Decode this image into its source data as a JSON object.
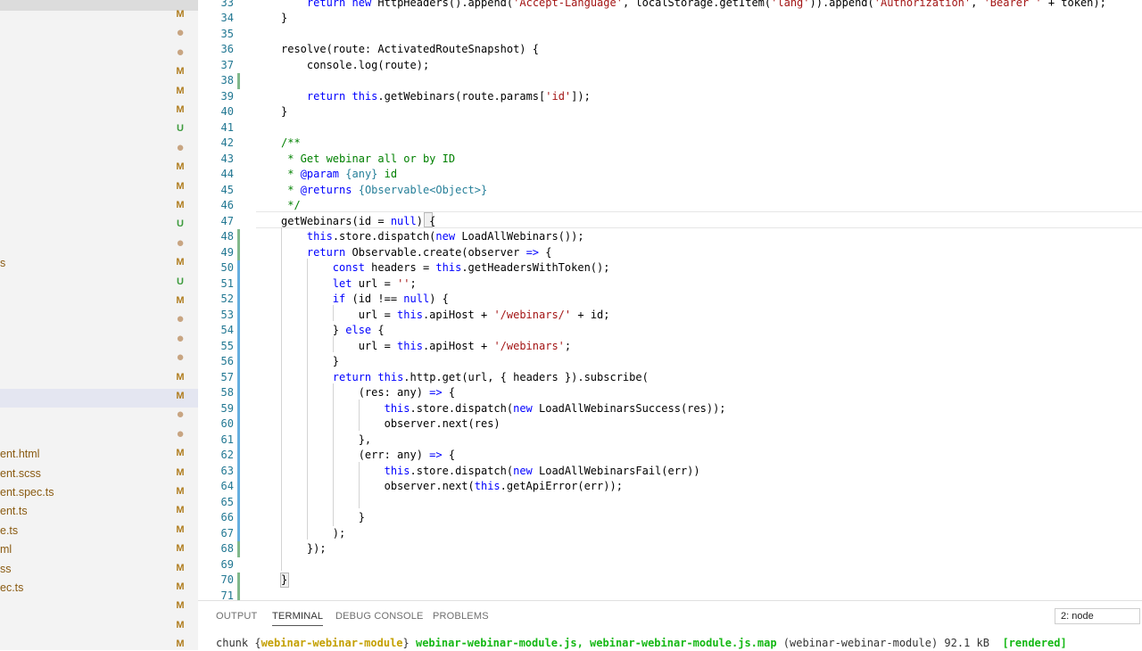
{
  "sidebar": {
    "rows": [
      {
        "name": "",
        "status": "M"
      },
      {
        "name": "",
        "status": "dot"
      },
      {
        "name": "",
        "status": "dot"
      },
      {
        "name": "",
        "status": "M"
      },
      {
        "name": "",
        "status": "M"
      },
      {
        "name": "",
        "status": "M"
      },
      {
        "name": "",
        "status": "U"
      },
      {
        "name": "",
        "status": "dot"
      },
      {
        "name": "",
        "status": "M"
      },
      {
        "name": "",
        "status": "M"
      },
      {
        "name": "",
        "status": "M"
      },
      {
        "name": "",
        "status": "U"
      },
      {
        "name": "",
        "status": "dot"
      },
      {
        "name": "s",
        "status": "M"
      },
      {
        "name": "",
        "status": "U"
      },
      {
        "name": "",
        "status": "M"
      },
      {
        "name": "",
        "status": "dot"
      },
      {
        "name": "",
        "status": "dot"
      },
      {
        "name": "",
        "status": "dot"
      },
      {
        "name": "",
        "status": "M"
      },
      {
        "name": "",
        "status": "M"
      },
      {
        "name": "",
        "status": "dot"
      },
      {
        "name": "",
        "status": "dot"
      },
      {
        "name": "ent.html",
        "status": "M"
      },
      {
        "name": "ent.scss",
        "status": "M"
      },
      {
        "name": "ent.spec.ts",
        "status": "M"
      },
      {
        "name": "ent.ts",
        "status": "M"
      },
      {
        "name": "e.ts",
        "status": "M"
      },
      {
        "name": "ml",
        "status": "M"
      },
      {
        "name": "ss",
        "status": "M"
      },
      {
        "name": "ec.ts",
        "status": "M"
      },
      {
        "name": "",
        "status": "M"
      },
      {
        "name": "",
        "status": "M"
      },
      {
        "name": "",
        "status": "M"
      }
    ]
  },
  "editor": {
    "lines": [
      {
        "n": "33",
        "html": "    <span class=\"kw\">return</span> <span class=\"kw\">new</span> HttpHeaders().append(<span class=\"str\">'Accept-Language'</span>, localStorage.getItem(<span class=\"str\">'lang'</span>)).append(<span class=\"str\">'Authorization'</span>, <span class=\"str\">'Bearer '</span> + token);"
      },
      {
        "n": "34",
        "html": "}"
      },
      {
        "n": "35",
        "html": ""
      },
      {
        "n": "36",
        "html": "resolve(route: ActivatedRouteSnapshot) {"
      },
      {
        "n": "37",
        "html": "    console.log(route);"
      },
      {
        "n": "38",
        "html": ""
      },
      {
        "n": "39",
        "html": "    <span class=\"kw\">return</span> <span class=\"kw\">this</span>.getWebinars(route.params[<span class=\"str\">'id'</span>]);"
      },
      {
        "n": "40",
        "html": "}"
      },
      {
        "n": "41",
        "html": ""
      },
      {
        "n": "42",
        "html": "<span class=\"cm\">/**</span>"
      },
      {
        "n": "43",
        "html": "<span class=\"cm\"> * Get webinar all or by ID</span>"
      },
      {
        "n": "44",
        "html": "<span class=\"cm\"> * </span><span class=\"cmtag\">@param</span><span class=\"cm\"> </span><span class=\"cmtype\">{any}</span><span class=\"cm\"> id</span>"
      },
      {
        "n": "45",
        "html": "<span class=\"cm\"> * </span><span class=\"cmtag\">@returns</span><span class=\"cm\"> </span><span class=\"cmtype\">{Observable&lt;Object&gt;}</span>"
      },
      {
        "n": "46",
        "html": "<span class=\"cm\"> */</span>"
      },
      {
        "n": "47",
        "html": "getWebinars(id = <span class=\"kw\">null</span>) {"
      },
      {
        "n": "48",
        "html": "    <span class=\"kw\">this</span>.store.dispatch(<span class=\"kw\">new</span> LoadAllWebinars());"
      },
      {
        "n": "49",
        "html": "    <span class=\"kw\">return</span> Observable.create(observer <span class=\"kw\">=&gt;</span> {"
      },
      {
        "n": "50",
        "html": "        <span class=\"kw\">const</span> headers = <span class=\"kw\">this</span>.getHeadersWithToken();"
      },
      {
        "n": "51",
        "html": "        <span class=\"kw\">let</span> url = <span class=\"str\">''</span>;"
      },
      {
        "n": "52",
        "html": "        <span class=\"kw\">if</span> (id !== <span class=\"kw\">null</span>) {"
      },
      {
        "n": "53",
        "html": "            url = <span class=\"kw\">this</span>.apiHost + <span class=\"str\">'/webinars/'</span> + id;"
      },
      {
        "n": "54",
        "html": "        } <span class=\"kw\">else</span> {"
      },
      {
        "n": "55",
        "html": "            url = <span class=\"kw\">this</span>.apiHost + <span class=\"str\">'/webinars'</span>;"
      },
      {
        "n": "56",
        "html": "        }"
      },
      {
        "n": "57",
        "html": "        <span class=\"kw\">return</span> <span class=\"kw\">this</span>.http.get(url, { headers }).subscribe("
      },
      {
        "n": "58",
        "html": "            (res: any) <span class=\"kw\">=&gt;</span> {"
      },
      {
        "n": "59",
        "html": "                <span class=\"kw\">this</span>.store.dispatch(<span class=\"kw\">new</span> LoadAllWebinarsSuccess(res));"
      },
      {
        "n": "60",
        "html": "                observer.next(res)"
      },
      {
        "n": "61",
        "html": "            },"
      },
      {
        "n": "62",
        "html": "            (err: any) <span class=\"kw\">=&gt;</span> {"
      },
      {
        "n": "63",
        "html": "                <span class=\"kw\">this</span>.store.dispatch(<span class=\"kw\">new</span> LoadAllWebinarsFail(err))"
      },
      {
        "n": "64",
        "html": "                observer.next(<span class=\"kw\">this</span>.getApiError(err));"
      },
      {
        "n": "65",
        "html": ""
      },
      {
        "n": "66",
        "html": "            }"
      },
      {
        "n": "67",
        "html": "        );"
      },
      {
        "n": "68",
        "html": "    });"
      },
      {
        "n": "69",
        "html": ""
      },
      {
        "n": "70",
        "html": "}"
      },
      {
        "n": "71",
        "html": ""
      }
    ]
  },
  "panel": {
    "tabs": [
      "OUTPUT",
      "TERMINAL",
      "DEBUG CONSOLE",
      "PROBLEMS"
    ],
    "active_tab": "TERMINAL",
    "terminal_select": "2: node",
    "terminal": {
      "prefix": "chunk {",
      "chunk_name": "webinar-webinar-module",
      "brace_close": "} ",
      "files": "webinar-webinar-module.js, webinar-webinar-module.js.map",
      "middle": " (webinar-webinar-module) 92.1 kB  ",
      "rendered": "[rendered]"
    }
  },
  "colors": {
    "modified": "#b07d1f",
    "untracked": "#3d9b3d",
    "keyword": "#0000ff",
    "string": "#a31515",
    "comment": "#008000",
    "line_number": "#237893",
    "gutter_added": "#81b88b",
    "gutter_modified": "#66afe0"
  }
}
